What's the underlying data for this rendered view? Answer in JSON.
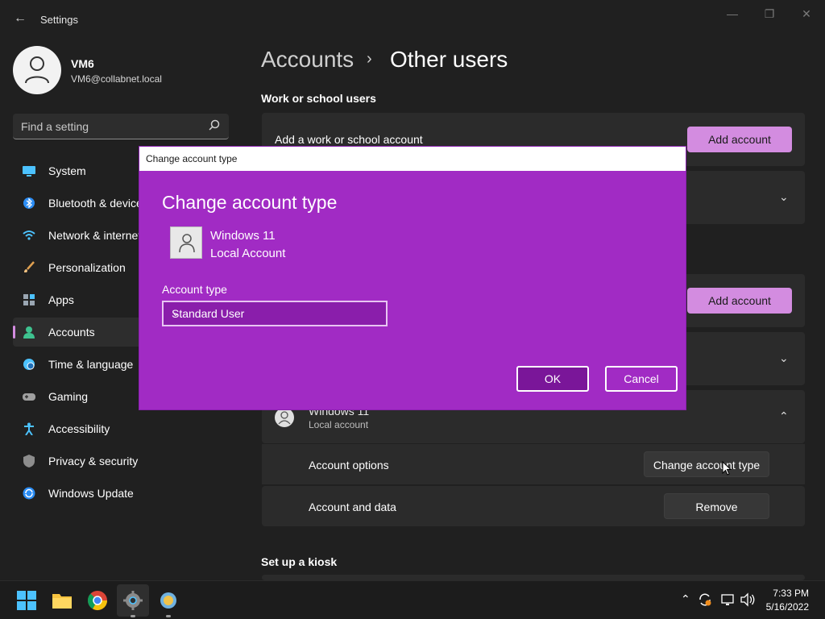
{
  "window": {
    "title": "Settings",
    "back_icon": "arrow-left-icon",
    "controls": [
      "minimize-icon",
      "restore-icon",
      "close-icon"
    ]
  },
  "profile": {
    "name": "VM6",
    "email": "VM6@collabnet.local"
  },
  "search": {
    "placeholder": "Find a setting"
  },
  "sidebar": {
    "items": [
      {
        "label": "System",
        "icon": "monitor-icon"
      },
      {
        "label": "Bluetooth & devices",
        "icon": "bluetooth-icon"
      },
      {
        "label": "Network & internet",
        "icon": "wifi-icon"
      },
      {
        "label": "Personalization",
        "icon": "brush-icon"
      },
      {
        "label": "Apps",
        "icon": "apps-icon"
      },
      {
        "label": "Accounts",
        "icon": "person-icon",
        "active": true
      },
      {
        "label": "Time & language",
        "icon": "globe-clock-icon"
      },
      {
        "label": "Gaming",
        "icon": "gamepad-icon"
      },
      {
        "label": "Accessibility",
        "icon": "accessibility-icon"
      },
      {
        "label": "Privacy & security",
        "icon": "shield-icon"
      },
      {
        "label": "Windows Update",
        "icon": "update-icon"
      }
    ]
  },
  "breadcrumb": {
    "parent": "Accounts",
    "separator": "›",
    "current": "Other users"
  },
  "main": {
    "work_section_title": "Work or school users",
    "work_row_label": "Add a work or school account",
    "add_account_label": "Add account",
    "user_row": {
      "name": "Windows 11",
      "type": "Local account"
    },
    "account_options_label": "Account options",
    "change_type_button": "Change account type",
    "account_data_label": "Account and data",
    "remove_button": "Remove",
    "kiosk_section_title": "Set up a kiosk"
  },
  "dialog": {
    "window_title": "Change account type",
    "heading": "Change account type",
    "user_name": "Windows 11",
    "user_type": "Local Account",
    "account_type_label": "Account type",
    "selected_type": "Standard User",
    "ok_label": "OK",
    "cancel_label": "Cancel"
  },
  "taskbar": {
    "apps": [
      "windows-start-icon",
      "file-explorer-icon",
      "chrome-icon",
      "settings-gear-icon",
      "app-icon"
    ],
    "tray": [
      "chevron-up-icon",
      "sync-icon",
      "network-icon",
      "volume-icon"
    ],
    "time": "7:33 PM",
    "date": "5/16/2022"
  },
  "colors": {
    "accent": "#d38ce0",
    "dialog_bg": "#a12bc4",
    "window_bg": "#202020",
    "card_bg": "#2b2b2b"
  }
}
